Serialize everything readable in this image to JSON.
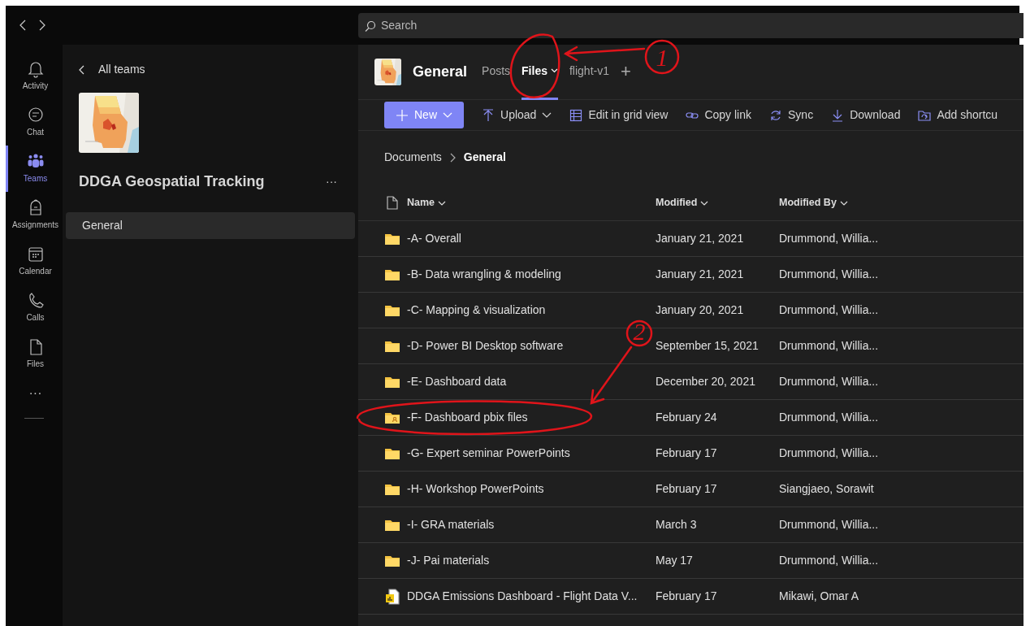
{
  "search": {
    "placeholder": "Search"
  },
  "rail": [
    {
      "kind": "activity",
      "label": "Activity",
      "selected": false
    },
    {
      "kind": "chat",
      "label": "Chat",
      "selected": false
    },
    {
      "kind": "teams",
      "label": "Teams",
      "selected": true
    },
    {
      "kind": "assignments",
      "label": "Assignments",
      "selected": false
    },
    {
      "kind": "calendar",
      "label": "Calendar",
      "selected": false
    },
    {
      "kind": "calls",
      "label": "Calls",
      "selected": false
    },
    {
      "kind": "files",
      "label": "Files",
      "selected": false
    }
  ],
  "rail_more": "···",
  "team_panel": {
    "back_label": "All teams",
    "team_name": "DDGA Geospatial Tracking",
    "more": "···",
    "channels": [
      {
        "label": "General",
        "selected": true
      }
    ]
  },
  "channel_header": {
    "title": "General",
    "tabs": [
      {
        "label": "Posts",
        "selected": false,
        "dropdown": false
      },
      {
        "label": "Files",
        "selected": true,
        "dropdown": true
      },
      {
        "label": "flight-v1",
        "selected": false,
        "dropdown": false
      }
    ],
    "add": "+"
  },
  "toolbar": [
    {
      "kind": "new",
      "label": "New",
      "primary": true,
      "dropdown": true
    },
    {
      "kind": "upload",
      "label": "Upload",
      "primary": false,
      "dropdown": true
    },
    {
      "kind": "grid",
      "label": "Edit in grid view",
      "primary": false,
      "dropdown": false
    },
    {
      "kind": "link",
      "label": "Copy link",
      "primary": false,
      "dropdown": false
    },
    {
      "kind": "sync",
      "label": "Sync",
      "primary": false,
      "dropdown": false
    },
    {
      "kind": "download",
      "label": "Download",
      "primary": false,
      "dropdown": false
    },
    {
      "kind": "shortcut",
      "label": "Add shortcu",
      "primary": false,
      "dropdown": false
    }
  ],
  "breadcrumb": [
    {
      "label": "Documents",
      "current": false
    },
    {
      "label": "General",
      "current": true
    }
  ],
  "table": {
    "columns": [
      "Name",
      "Modified",
      "Modified By"
    ],
    "rows": [
      {
        "kind": "folder",
        "name": "-A- Overall",
        "modified": "January 21, 2021",
        "modified_by": "Drummond, Willia..."
      },
      {
        "kind": "folder",
        "name": "-B- Data wrangling & modeling",
        "modified": "January 21, 2021",
        "modified_by": "Drummond, Willia..."
      },
      {
        "kind": "folder",
        "name": "-C- Mapping & visualization",
        "modified": "January 20, 2021",
        "modified_by": "Drummond, Willia..."
      },
      {
        "kind": "folder",
        "name": "-D- Power BI Desktop software",
        "modified": "September 15, 2021",
        "modified_by": "Drummond, Willia..."
      },
      {
        "kind": "folder",
        "name": "-E- Dashboard data",
        "modified": "December 20, 2021",
        "modified_by": "Drummond, Willia..."
      },
      {
        "kind": "shared-folder",
        "name": "-F- Dashboard pbix files",
        "modified": "February 24",
        "modified_by": "Drummond, Willia..."
      },
      {
        "kind": "folder",
        "name": "-G- Expert seminar PowerPoints",
        "modified": "February 17",
        "modified_by": "Drummond, Willia..."
      },
      {
        "kind": "folder",
        "name": "-H- Workshop PowerPoints",
        "modified": "February 17",
        "modified_by": "Siangjaeo, Sorawit"
      },
      {
        "kind": "folder",
        "name": "-I- GRA materials",
        "modified": "March 3",
        "modified_by": "Drummond, Willia..."
      },
      {
        "kind": "folder",
        "name": "-J- Pai materials",
        "modified": "May 17",
        "modified_by": "Drummond, Willia..."
      },
      {
        "kind": "pbix",
        "name": "DDGA Emissions Dashboard - Flight Data V...",
        "modified": "February 17",
        "modified_by": "Mikawi, Omar A"
      }
    ]
  },
  "annotations": [
    {
      "label": "1"
    },
    {
      "label": "2"
    }
  ]
}
